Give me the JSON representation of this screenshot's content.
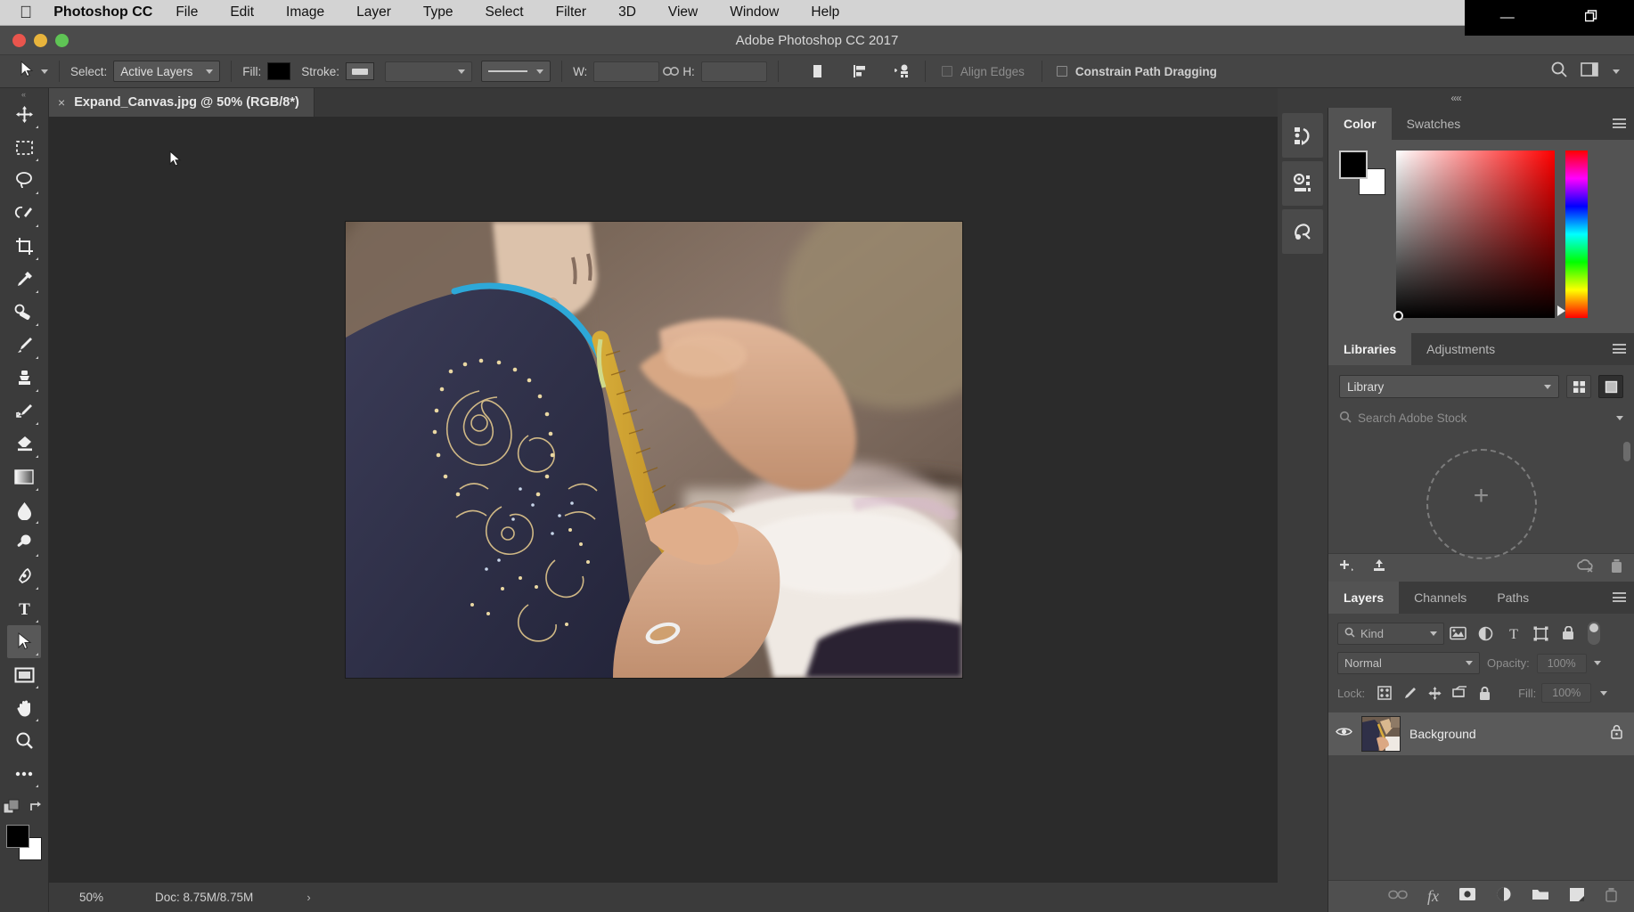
{
  "macbar": {
    "apple_icon": "apple-logo-icon",
    "app_name": "Photoshop CC",
    "menus": [
      "File",
      "Edit",
      "Image",
      "Layer",
      "Type",
      "Select",
      "Filter",
      "3D",
      "View",
      "Window",
      "Help"
    ],
    "status_icons": [
      "display-icon",
      "screen-record-icon",
      "creative-cloud-icon",
      "wifi-icon"
    ]
  },
  "window_controls": {
    "minimize": "—",
    "maximize": "❐"
  },
  "titlebar": {
    "title": "Adobe Photoshop CC 2017"
  },
  "options_bar": {
    "tool_icon": "path-selection-tool-icon",
    "select_label": "Select:",
    "select_value": "Active Layers",
    "fill_label": "Fill:",
    "fill_color": "#000000",
    "stroke_label": "Stroke:",
    "stroke_color": "#d6d6d6",
    "stroke_width_value": "",
    "stroke_type_value": "",
    "w_label": "W:",
    "w_value": "",
    "link_icon": "link-icon",
    "h_label": "H:",
    "h_value": "",
    "path_ops_icon": "path-operations-icon",
    "path_align_icon": "path-alignment-icon",
    "path_arrange_icon": "path-arrangement-icon",
    "align_edges_label": "Align Edges",
    "align_edges_checked": false,
    "constrain_label": "Constrain Path Dragging",
    "constrain_checked": false,
    "search_icon": "search-icon",
    "workspace_icon": "workspace-switcher-icon"
  },
  "document_tab": {
    "close_icon": "×",
    "title": "Expand_Canvas.jpg @ 50% (RGB/8*)"
  },
  "toolbar": {
    "grip": "«",
    "tools": [
      {
        "name": "move-tool",
        "has_flyout": true,
        "active": false
      },
      {
        "name": "rectangular-marquee-tool",
        "has_flyout": true,
        "active": false
      },
      {
        "name": "lasso-tool",
        "has_flyout": true,
        "active": false
      },
      {
        "name": "quick-selection-tool",
        "has_flyout": true,
        "active": false
      },
      {
        "name": "crop-tool",
        "has_flyout": true,
        "active": false
      },
      {
        "name": "eyedropper-tool",
        "has_flyout": true,
        "active": false
      },
      {
        "name": "spot-healing-brush-tool",
        "has_flyout": true,
        "active": false
      },
      {
        "name": "brush-tool",
        "has_flyout": true,
        "active": false
      },
      {
        "name": "clone-stamp-tool",
        "has_flyout": true,
        "active": false
      },
      {
        "name": "history-brush-tool",
        "has_flyout": true,
        "active": false
      },
      {
        "name": "eraser-tool",
        "has_flyout": true,
        "active": false
      },
      {
        "name": "gradient-tool",
        "has_flyout": true,
        "active": false
      },
      {
        "name": "blur-tool",
        "has_flyout": true,
        "active": false
      },
      {
        "name": "dodge-tool",
        "has_flyout": true,
        "active": false
      },
      {
        "name": "pen-tool",
        "has_flyout": true,
        "active": false
      },
      {
        "name": "horizontal-type-tool",
        "has_flyout": true,
        "active": false
      },
      {
        "name": "path-selection-tool",
        "has_flyout": true,
        "active": true
      },
      {
        "name": "rectangle-tool",
        "has_flyout": true,
        "active": false
      },
      {
        "name": "hand-tool",
        "has_flyout": true,
        "active": false
      },
      {
        "name": "zoom-tool",
        "has_flyout": false,
        "active": false
      },
      {
        "name": "edit-toolbar-tool",
        "has_flyout": true,
        "active": false
      }
    ],
    "quick_mask_icon": "quick-mask-icon",
    "screen_mode_icon": "screen-mode-icon",
    "foreground_color": "#000000",
    "background_color": "#ffffff"
  },
  "canvas": {
    "cursor_icon": "arrow-cursor-icon",
    "image_alt": "tailor-measuring-embroidered-garment"
  },
  "status_bar": {
    "zoom": "50%",
    "doc_info": "Doc: 8.75M/8.75M",
    "expander": "›"
  },
  "dock": {
    "collapse_icon": "««",
    "rail_buttons": [
      "history-panel-icon",
      "properties-panel-icon",
      "styles-panel-icon"
    ]
  },
  "color_panel": {
    "tabs": [
      {
        "label": "Color",
        "active": true
      },
      {
        "label": "Swatches",
        "active": false
      }
    ],
    "menu_icon": "panel-menu-icon",
    "foreground_color": "#000000",
    "background_color": "#ffffff",
    "spectrum_base_hue": "#ff0000"
  },
  "libraries_panel": {
    "tabs": [
      {
        "label": "Libraries",
        "active": true
      },
      {
        "label": "Adjustments",
        "active": false
      }
    ],
    "menu_icon": "panel-menu-icon",
    "library_select_value": "Library",
    "view_grid_icon": "grid-view-icon",
    "view_list_icon": "list-view-icon",
    "search_icon": "search-icon",
    "search_placeholder": "Search Adobe Stock",
    "empty_plus": "+",
    "footer_icons": [
      "add-element-icon",
      "upload-icon",
      "sync-off-icon",
      "delete-icon"
    ]
  },
  "layers_panel": {
    "tabs": [
      {
        "label": "Layers",
        "active": true
      },
      {
        "label": "Channels",
        "active": false
      },
      {
        "label": "Paths",
        "active": false
      }
    ],
    "menu_icon": "panel-menu-icon",
    "filter_kind_label": "Kind",
    "filter_icons": [
      "filter-image-icon",
      "filter-adjustment-icon",
      "filter-type-icon",
      "filter-shape-icon",
      "filter-smart-object-icon"
    ],
    "blend_mode": "Normal",
    "opacity_label": "Opacity:",
    "opacity_value": "100%",
    "lock_label": "Lock:",
    "lock_icons": [
      "lock-transparent-pixels-icon",
      "lock-image-pixels-icon",
      "lock-position-icon",
      "lock-artboard-nesting-icon",
      "lock-all-icon"
    ],
    "fill_label": "Fill:",
    "fill_value": "100%",
    "layers": [
      {
        "name": "Background",
        "visible": true,
        "locked": true,
        "visibility_icon": "eye-icon",
        "lock_icon": "lock-icon",
        "thumbnail": "background-layer-thumbnail"
      }
    ],
    "footer_icons": [
      "link-layers-icon",
      "layer-style-fx-icon",
      "add-layer-mask-icon",
      "new-adjustment-layer-icon",
      "new-group-icon",
      "new-layer-icon",
      "delete-layer-icon"
    ],
    "footer_fx_label": "fx"
  },
  "colors": {
    "menubar_bg": "#d3d3d3",
    "titlebar_bg": "#4b4b4b",
    "options_bg": "#454545",
    "panel_bg": "#454545",
    "canvas_bg": "#2b2b2b",
    "accent_red": "#ff0000"
  }
}
